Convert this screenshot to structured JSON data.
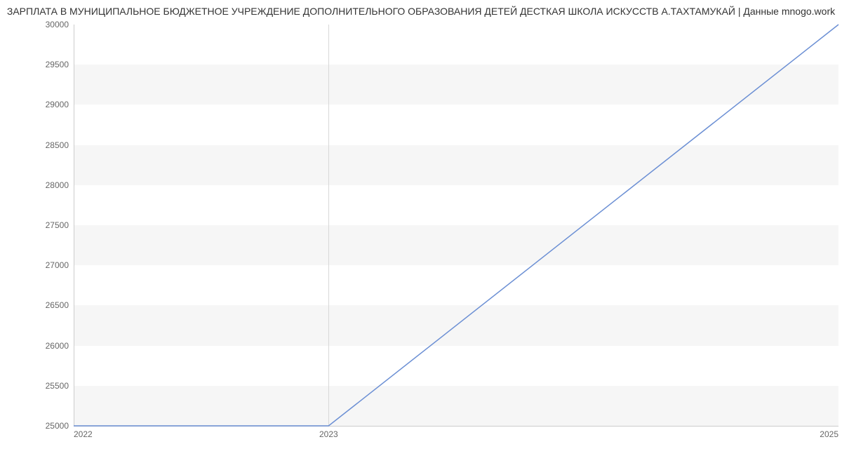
{
  "chart_data": {
    "type": "line",
    "title": "ЗАРПЛАТА В МУНИЦИПАЛЬНОЕ БЮДЖЕТНОЕ УЧРЕЖДЕНИЕ ДОПОЛНИТЕЛЬНОГО ОБРАЗОВАНИЯ ДЕТЕЙ ДЕСТКАЯ ШКОЛА ИСКУССТВ А.ТАХТАМУКАЙ | Данные mnogo.work",
    "xlabel": "",
    "ylabel": "",
    "x": [
      2022,
      2023,
      2025
    ],
    "series": [
      {
        "name": "salary",
        "values": [
          25000,
          25000,
          30000
        ],
        "color": "#6b8fd4"
      }
    ],
    "yticks": [
      25000,
      25500,
      26000,
      26500,
      27000,
      27500,
      28000,
      28500,
      29000,
      29500,
      30000
    ],
    "xticks": [
      2022,
      2023,
      2025
    ],
    "ylim": [
      25000,
      30000
    ],
    "xlim": [
      2022,
      2025
    ],
    "grid": true,
    "legend": false
  }
}
